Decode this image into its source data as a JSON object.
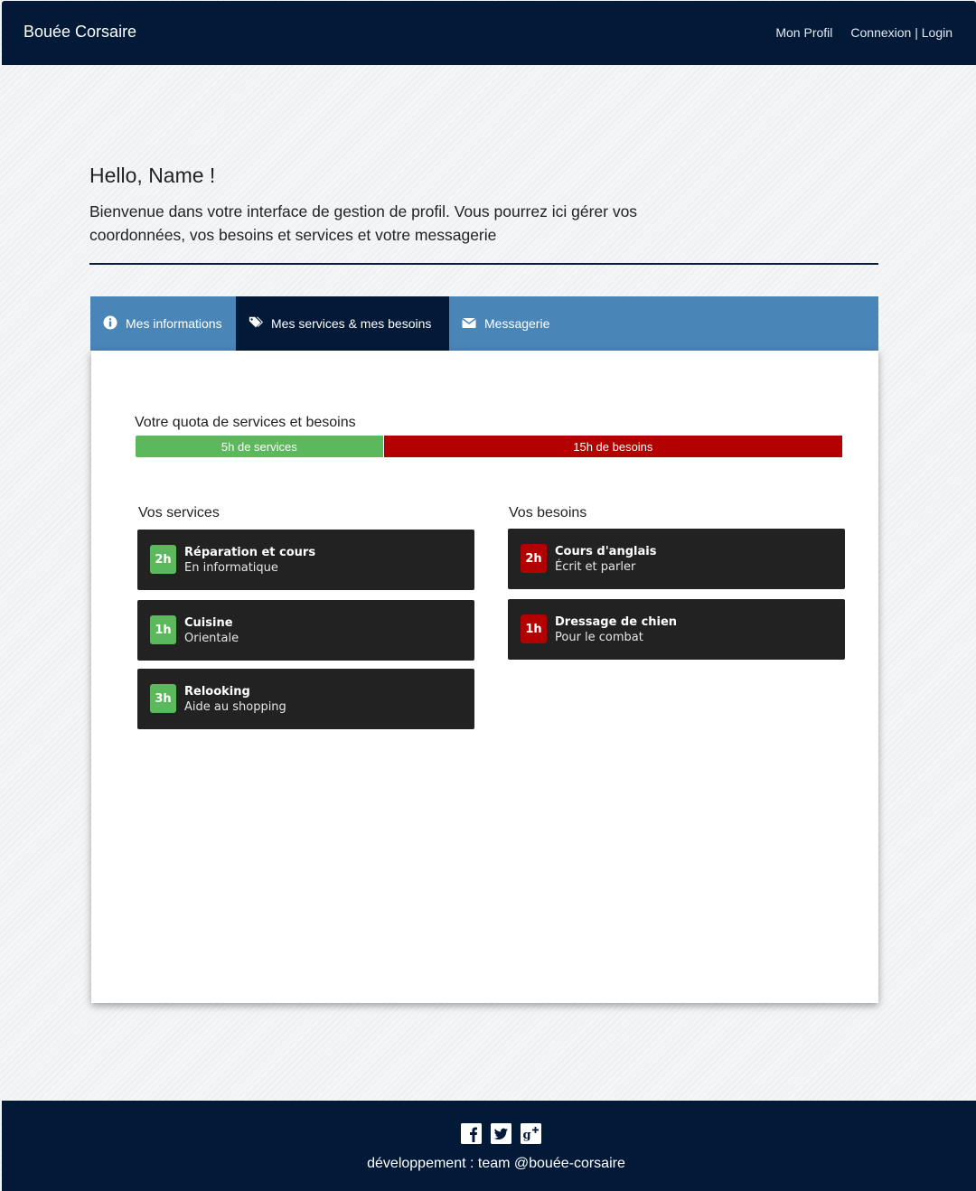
{
  "navbar": {
    "brand": "Bouée Corsaire",
    "links": [
      "Mon Profil",
      "Connexion | Login"
    ]
  },
  "header": {
    "greeting": "Hello, Name !",
    "intro": "Bienvenue dans votre interface de gestion de profil. Vous pourrez ici gérer vos coordonnées, vos besoins et services et votre messagerie"
  },
  "tabs": [
    {
      "label": "Mes informations",
      "icon": "info-circle-icon",
      "active": false
    },
    {
      "label": "Mes services & mes besoins",
      "icon": "tags-icon",
      "active": true
    },
    {
      "label": "Messagerie",
      "icon": "envelope-icon",
      "active": false
    }
  ],
  "quota": {
    "title": "Votre quota de services et besoins",
    "services_label": "5h de services",
    "besoins_label": "15h de besoins",
    "services_hours": 5,
    "besoins_hours": 15,
    "services_color": "#5cb85c",
    "besoins_color": "#b30000"
  },
  "services": {
    "title": "Vos services",
    "items": [
      {
        "hours": "2h",
        "title": "Réparation et cours",
        "subtitle": "En informatique"
      },
      {
        "hours": "1h",
        "title": "Cuisine",
        "subtitle": "Orientale"
      },
      {
        "hours": "3h",
        "title": "Relooking",
        "subtitle": "Aide au shopping"
      }
    ]
  },
  "besoins": {
    "title": "Vos besoins",
    "items": [
      {
        "hours": "2h",
        "title": "Cours d'anglais",
        "subtitle": "Écrit et parler"
      },
      {
        "hours": "1h",
        "title": "Dressage de chien",
        "subtitle": "Pour le combat"
      }
    ]
  },
  "footer": {
    "social": [
      "facebook-icon",
      "twitter-icon",
      "google-plus-icon"
    ],
    "text": "développement : team @bouée-corsaire"
  },
  "colors": {
    "navy": "#021a38",
    "tab_bar": "#4a85b8",
    "card_bg": "#222222"
  }
}
